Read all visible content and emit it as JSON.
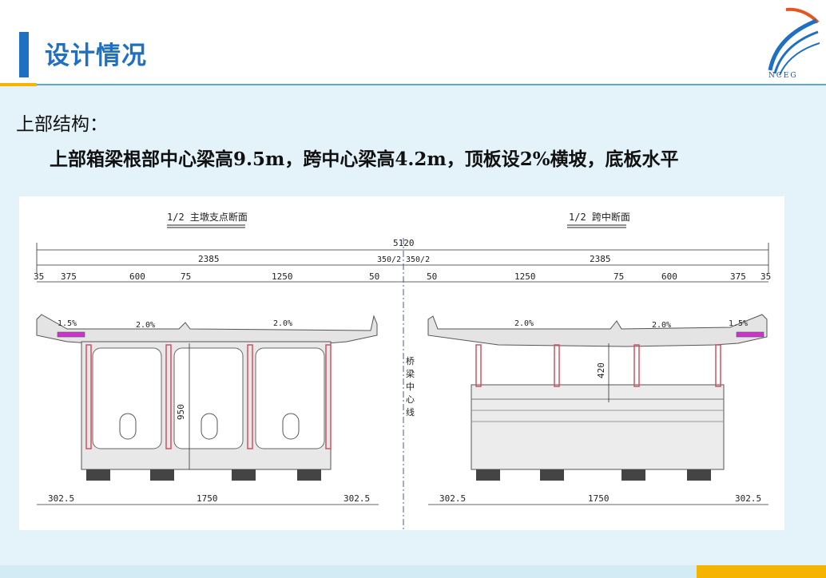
{
  "slide": {
    "title": "设计情况",
    "logo_text": "NCEG",
    "heading": "上部结构：",
    "description": "上部箱梁根部中心梁高9.5m，跨中心梁高4.2m，顶板设2%横坡，底板水平"
  },
  "drawing": {
    "left_title": "1/2 主墩支点断面",
    "right_title": "1/2 跨中断面",
    "total_width": "5120",
    "left_half": "2385",
    "right_half": "2385",
    "center_left": "350/2",
    "center_right": "350/2",
    "left_dims": [
      "35",
      "375",
      "600",
      "75",
      "1250",
      "50"
    ],
    "right_dims": [
      "50",
      "1250",
      "75",
      "600",
      "375",
      "35"
    ],
    "slope_side_left": "1.5%",
    "slope_left_1": "2.0%",
    "slope_left_2": "2.0%",
    "slope_right_1": "2.0%",
    "slope_right_2": "2.0%",
    "slope_side_right": "1.5%",
    "center_label": [
      "桥",
      "梁",
      "中",
      "心",
      "线"
    ],
    "height_root": "950",
    "height_mid": "420",
    "bottom_left": [
      "302.5",
      "1750",
      "302.5"
    ],
    "bottom_right": [
      "302.5",
      "1750",
      "302.5"
    ]
  },
  "colors": {
    "title_blue": "#1f6fc2",
    "accent_yellow": "#f5b400",
    "background": "#e3f3f9"
  }
}
